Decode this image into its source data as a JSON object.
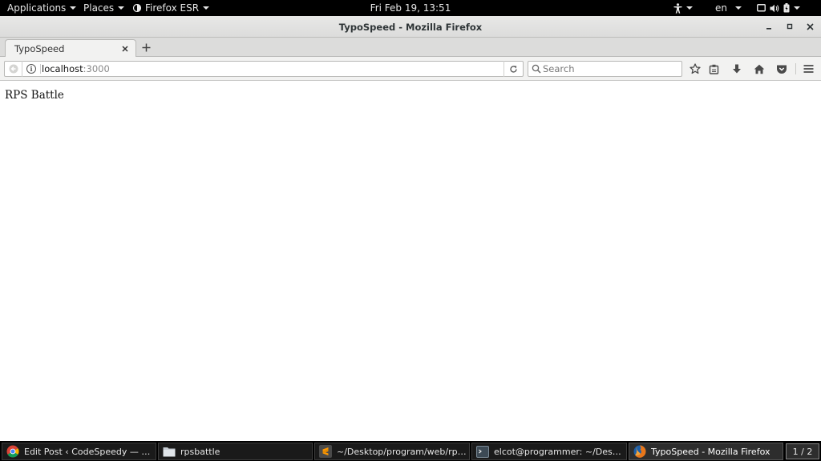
{
  "topbar": {
    "applications": "Applications",
    "places": "Places",
    "app_menu": "Firefox ESR",
    "clock": "Fri Feb 19, 13:51",
    "language": "en"
  },
  "window": {
    "title": "TypoSpeed - Mozilla Firefox"
  },
  "tabs": [
    {
      "title": "TypoSpeed"
    }
  ],
  "urlbar": {
    "host": "localhost",
    "port": ":3000"
  },
  "search": {
    "placeholder": "Search"
  },
  "page": {
    "heading": "RPS Battle"
  },
  "taskbar": {
    "items": [
      {
        "label": "Edit Post ‹ CodeSpeedy — Word...",
        "icon": "chrome-icon"
      },
      {
        "label": "rpsbattle",
        "icon": "folder-icon"
      },
      {
        "label": "~/Desktop/program/web/rpsbattl...",
        "icon": "sublime-text-icon"
      },
      {
        "label": "elcot@programmer: ~/Desktop/p...",
        "icon": "terminal-icon"
      },
      {
        "label": "TypoSpeed - Mozilla Firefox",
        "icon": "firefox-icon",
        "active": true
      }
    ],
    "workspace": "1 / 2"
  }
}
